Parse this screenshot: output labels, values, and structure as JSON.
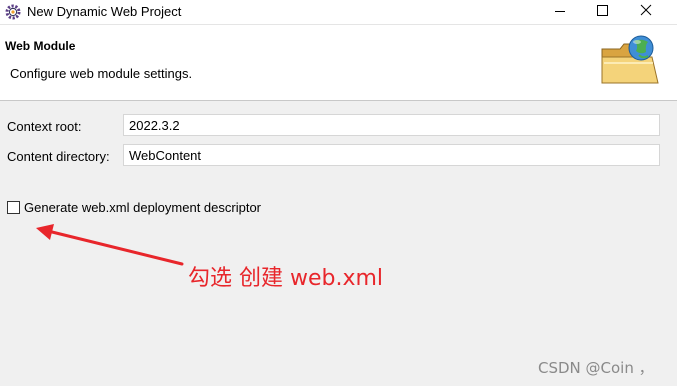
{
  "window": {
    "title": "New Dynamic Web Project",
    "icon": "eclipse-gear-icon",
    "controls": [
      "minimize-icon",
      "maximize-icon",
      "close-icon"
    ]
  },
  "header": {
    "title": "Web Module",
    "description": "Configure web module settings.",
    "icon": "web-folder-globe-icon"
  },
  "form": {
    "context_root": {
      "label": "Context root:",
      "value": "2022.3.2"
    },
    "content_directory": {
      "label": "Content directory:",
      "value": "WebContent"
    },
    "generate_webxml": {
      "label": "Generate web.xml deployment descriptor",
      "checked": false
    }
  },
  "annotation": {
    "text": "勾选 创建 web.xml",
    "color": "#e8262b"
  },
  "watermark": {
    "text": "CSDN @Coin ，"
  }
}
